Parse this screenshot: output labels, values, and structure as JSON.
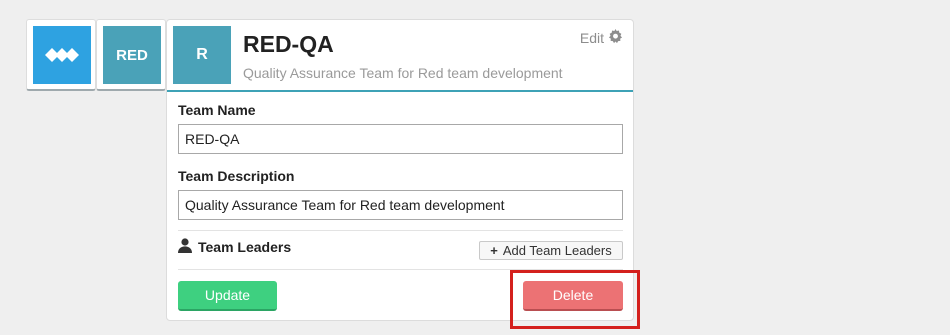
{
  "tiles": [
    {
      "icon": "company-logo-icon",
      "color": "#2ea2e1"
    },
    {
      "label": "RED",
      "color": "#4aa2b8"
    }
  ],
  "card": {
    "avatar_letter": "R",
    "title": "RED-QA",
    "subtitle": "Quality Assurance Team for Red team development",
    "edit_label": "Edit",
    "accent": "#3ea2b6"
  },
  "form": {
    "team_name_label": "Team Name",
    "team_name_value": "RED-QA",
    "team_description_label": "Team Description",
    "team_description_value": "Quality Assurance Team for Red team development",
    "team_leaders_label": "Team Leaders",
    "add_team_leaders_label": "Add Team Leaders",
    "update_label": "Update",
    "delete_label": "Delete"
  },
  "colors": {
    "update": "#3ed080",
    "delete": "#ec7274",
    "highlight": "#d4201d"
  }
}
